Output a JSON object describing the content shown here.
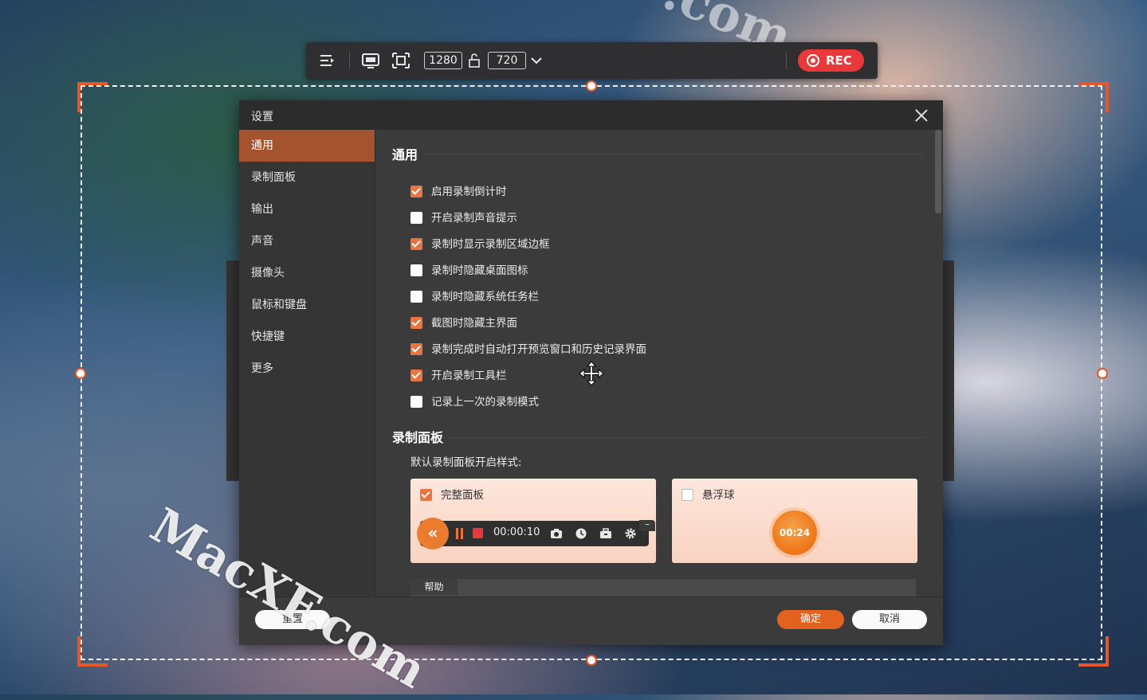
{
  "toolbar": {
    "width_value": "1280",
    "height_value": "720",
    "rec_label": "REC"
  },
  "dialog": {
    "title": "设置",
    "sidebar": [
      {
        "label": "通用",
        "active": true
      },
      {
        "label": "录制面板"
      },
      {
        "label": "输出"
      },
      {
        "label": "声音"
      },
      {
        "label": "摄像头"
      },
      {
        "label": "鼠标和键盘"
      },
      {
        "label": "快捷键"
      },
      {
        "label": "更多"
      }
    ],
    "general": {
      "title": "通用",
      "options": [
        {
          "label": "启用录制倒计时",
          "checked": true
        },
        {
          "label": "开启录制声音提示",
          "checked": false
        },
        {
          "label": "录制时显示录制区域边框",
          "checked": true
        },
        {
          "label": "录制时隐藏桌面图标",
          "checked": false
        },
        {
          "label": "录制时隐藏系统任务栏",
          "checked": false
        },
        {
          "label": "截图时隐藏主界面",
          "checked": true
        },
        {
          "label": "录制完成时自动打开预览窗口和历史记录界面",
          "checked": true
        },
        {
          "label": "开启录制工具栏",
          "checked": true
        },
        {
          "label": "记录上一次的录制模式",
          "checked": false
        }
      ]
    },
    "panel": {
      "title": "录制面板",
      "subtitle": "默认录制面板开启样式:",
      "full_panel_label": "完整面板",
      "full_panel_checked": true,
      "mini_time": "00:00:10",
      "float_label": "悬浮球",
      "float_checked": false,
      "float_time": "00:24"
    },
    "help_tab": "帮助",
    "buttons": {
      "reset": "重置",
      "ok": "确定",
      "cancel": "取消"
    }
  },
  "watermark": "MacXF.com",
  "watermark_top": ".com",
  "colors": {
    "accent": "#e8753f",
    "rec": "#e9393a",
    "frame": "#e8572a"
  }
}
